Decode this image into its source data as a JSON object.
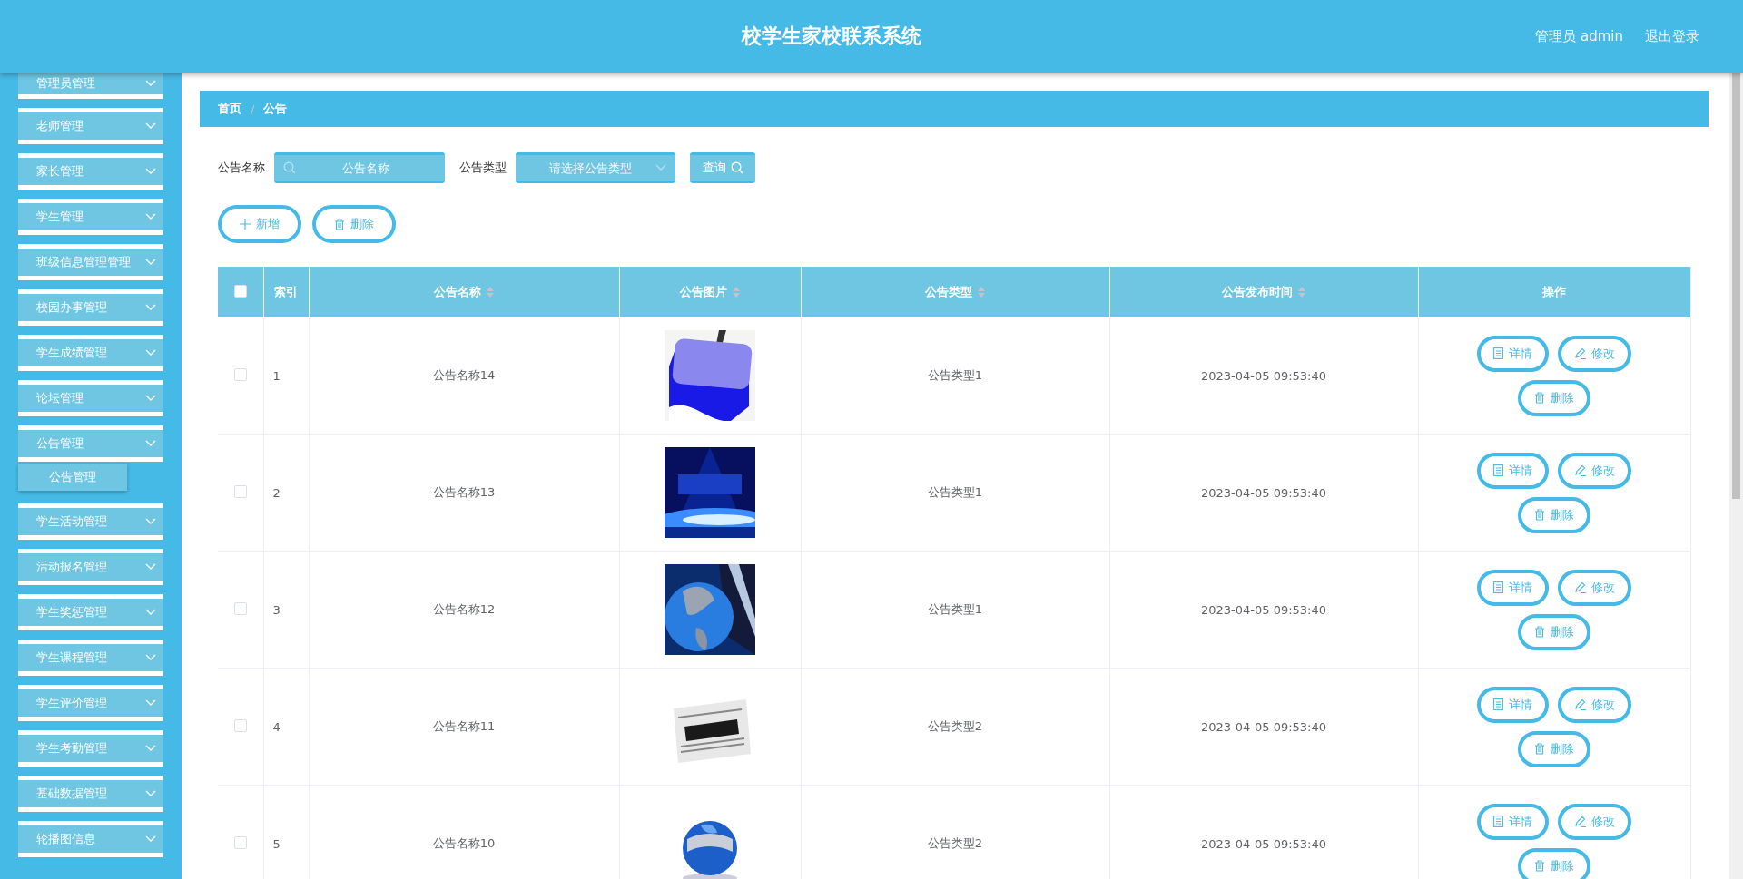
{
  "header": {
    "title": "校学生家校联系系统",
    "user": "管理员 admin",
    "logout": "退出登录"
  },
  "sidebar": {
    "items": [
      {
        "label": "管理员管理"
      },
      {
        "label": "老师管理"
      },
      {
        "label": "家长管理"
      },
      {
        "label": "学生管理"
      },
      {
        "label": "班级信息管理管理"
      },
      {
        "label": "校园办事管理"
      },
      {
        "label": "学生成绩管理"
      },
      {
        "label": "论坛管理"
      },
      {
        "label": "公告管理",
        "children": [
          {
            "label": "公告管理"
          }
        ]
      },
      {
        "label": "学生活动管理"
      },
      {
        "label": "活动报名管理"
      },
      {
        "label": "学生奖惩管理"
      },
      {
        "label": "学生课程管理"
      },
      {
        "label": "学生评价管理"
      },
      {
        "label": "学生考勤管理"
      },
      {
        "label": "基础数据管理"
      },
      {
        "label": "轮播图信息"
      }
    ]
  },
  "breadcrumb": {
    "items": [
      "首页",
      "公告"
    ],
    "separator": "/"
  },
  "filters": [
    {
      "kind": "text",
      "label": "公告名称",
      "placeholder": "公告名称"
    },
    {
      "kind": "select",
      "label": "公告类型",
      "placeholder": "请选择公告类型"
    }
  ],
  "search_button": "查询",
  "toolbar": [
    {
      "kind": "add",
      "label": "新增"
    },
    {
      "kind": "delete",
      "label": "删除"
    }
  ],
  "table": {
    "select_all_checked": false,
    "columns": [
      {
        "label": "索引",
        "sortable": false
      },
      {
        "label": "公告名称",
        "sortable": true
      },
      {
        "label": "公告图片",
        "sortable": true
      },
      {
        "label": "公告类型",
        "sortable": true
      },
      {
        "label": "公告发布时间",
        "sortable": true
      },
      {
        "label": "操作",
        "sortable": false
      }
    ],
    "rows": [
      {
        "checked": false,
        "index": "1",
        "name": "公告名称14",
        "type": "公告类型1",
        "time": "2023-04-05 09:53:40",
        "actions": [
          {
            "kind": "detail",
            "label": "详情"
          },
          {
            "kind": "edit",
            "label": "修改"
          },
          {
            "kind": "delete",
            "label": "删除"
          }
        ]
      },
      {
        "checked": false,
        "index": "2",
        "name": "公告名称13",
        "type": "公告类型1",
        "time": "2023-04-05 09:53:40",
        "actions": [
          {
            "kind": "detail",
            "label": "详情"
          },
          {
            "kind": "edit",
            "label": "修改"
          },
          {
            "kind": "delete",
            "label": "删除"
          }
        ]
      },
      {
        "checked": false,
        "index": "3",
        "name": "公告名称12",
        "type": "公告类型1",
        "time": "2023-04-05 09:53:40",
        "actions": [
          {
            "kind": "detail",
            "label": "详情"
          },
          {
            "kind": "edit",
            "label": "修改"
          },
          {
            "kind": "delete",
            "label": "删除"
          }
        ]
      },
      {
        "checked": false,
        "index": "4",
        "name": "公告名称11",
        "type": "公告类型2",
        "time": "2023-04-05 09:53:40",
        "actions": [
          {
            "kind": "detail",
            "label": "详情"
          },
          {
            "kind": "edit",
            "label": "修改"
          },
          {
            "kind": "delete",
            "label": "删除"
          }
        ]
      },
      {
        "checked": false,
        "index": "5",
        "name": "公告名称10",
        "type": "公告类型2",
        "time": "2023-04-05 09:53:40",
        "actions": [
          {
            "kind": "detail",
            "label": "详情"
          },
          {
            "kind": "edit",
            "label": "修改"
          },
          {
            "kind": "delete",
            "label": "删除"
          }
        ]
      }
    ]
  }
}
